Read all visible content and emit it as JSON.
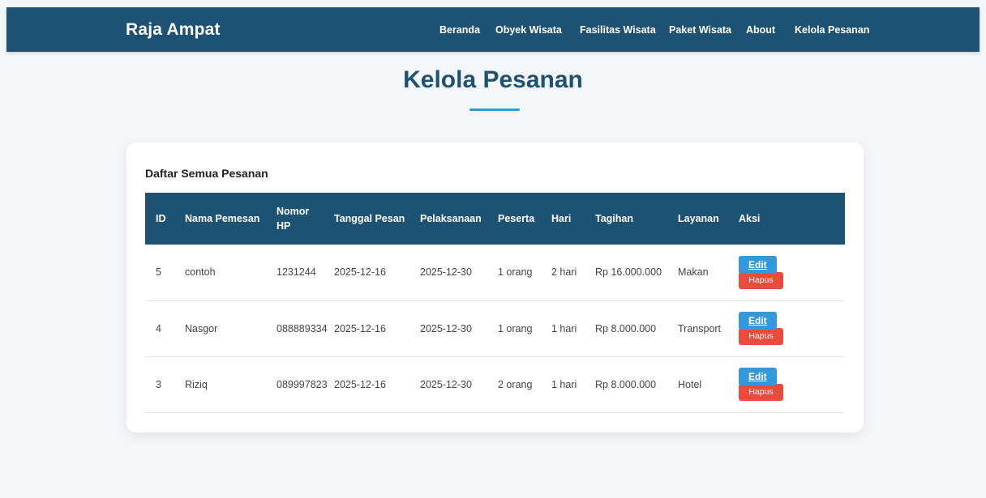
{
  "navbar": {
    "brand": "Raja Ampat",
    "links": [
      "Beranda",
      "Obyek Wisata",
      "Fasilitas Wisata",
      "Paket Wisata",
      "About",
      "Kelola Pesanan"
    ]
  },
  "page": {
    "title": "Kelola Pesanan"
  },
  "card": {
    "title": "Daftar Semua Pesanan"
  },
  "table": {
    "headers": [
      "ID",
      "Nama Pemesan",
      "Nomor HP",
      "Tanggal Pesan",
      "Pelaksanaan",
      "Peserta",
      "Hari",
      "Tagihan",
      "Layanan",
      "Aksi"
    ],
    "rows": [
      {
        "id": "5",
        "nama": "contoh",
        "hp": "1231244",
        "tanggal": "2025-12-16",
        "pelaksanaan": "2025-12-30",
        "peserta": "1 orang",
        "hari": "2 hari",
        "tagihan": "Rp 16.000.000",
        "layanan": "Makan"
      },
      {
        "id": "4",
        "nama": "Nasgor",
        "hp": "088889334",
        "tanggal": "2025-12-16",
        "pelaksanaan": "2025-12-30",
        "peserta": "1 orang",
        "hari": "1 hari",
        "tagihan": "Rp 8.000.000",
        "layanan": "Transport"
      },
      {
        "id": "3",
        "nama": "Riziq",
        "hp": "089997823",
        "tanggal": "2025-12-16",
        "pelaksanaan": "2025-12-30",
        "peserta": "2 orang",
        "hari": "1 hari",
        "tagihan": "Rp 8.000.000",
        "layanan": "Hotel"
      }
    ],
    "edit_label": "Edit",
    "hapus_label": "Hapus"
  },
  "colors": {
    "primary": "#1e5274",
    "accent": "#3498db",
    "danger": "#e74c3c",
    "background": "#f4f6f9"
  }
}
